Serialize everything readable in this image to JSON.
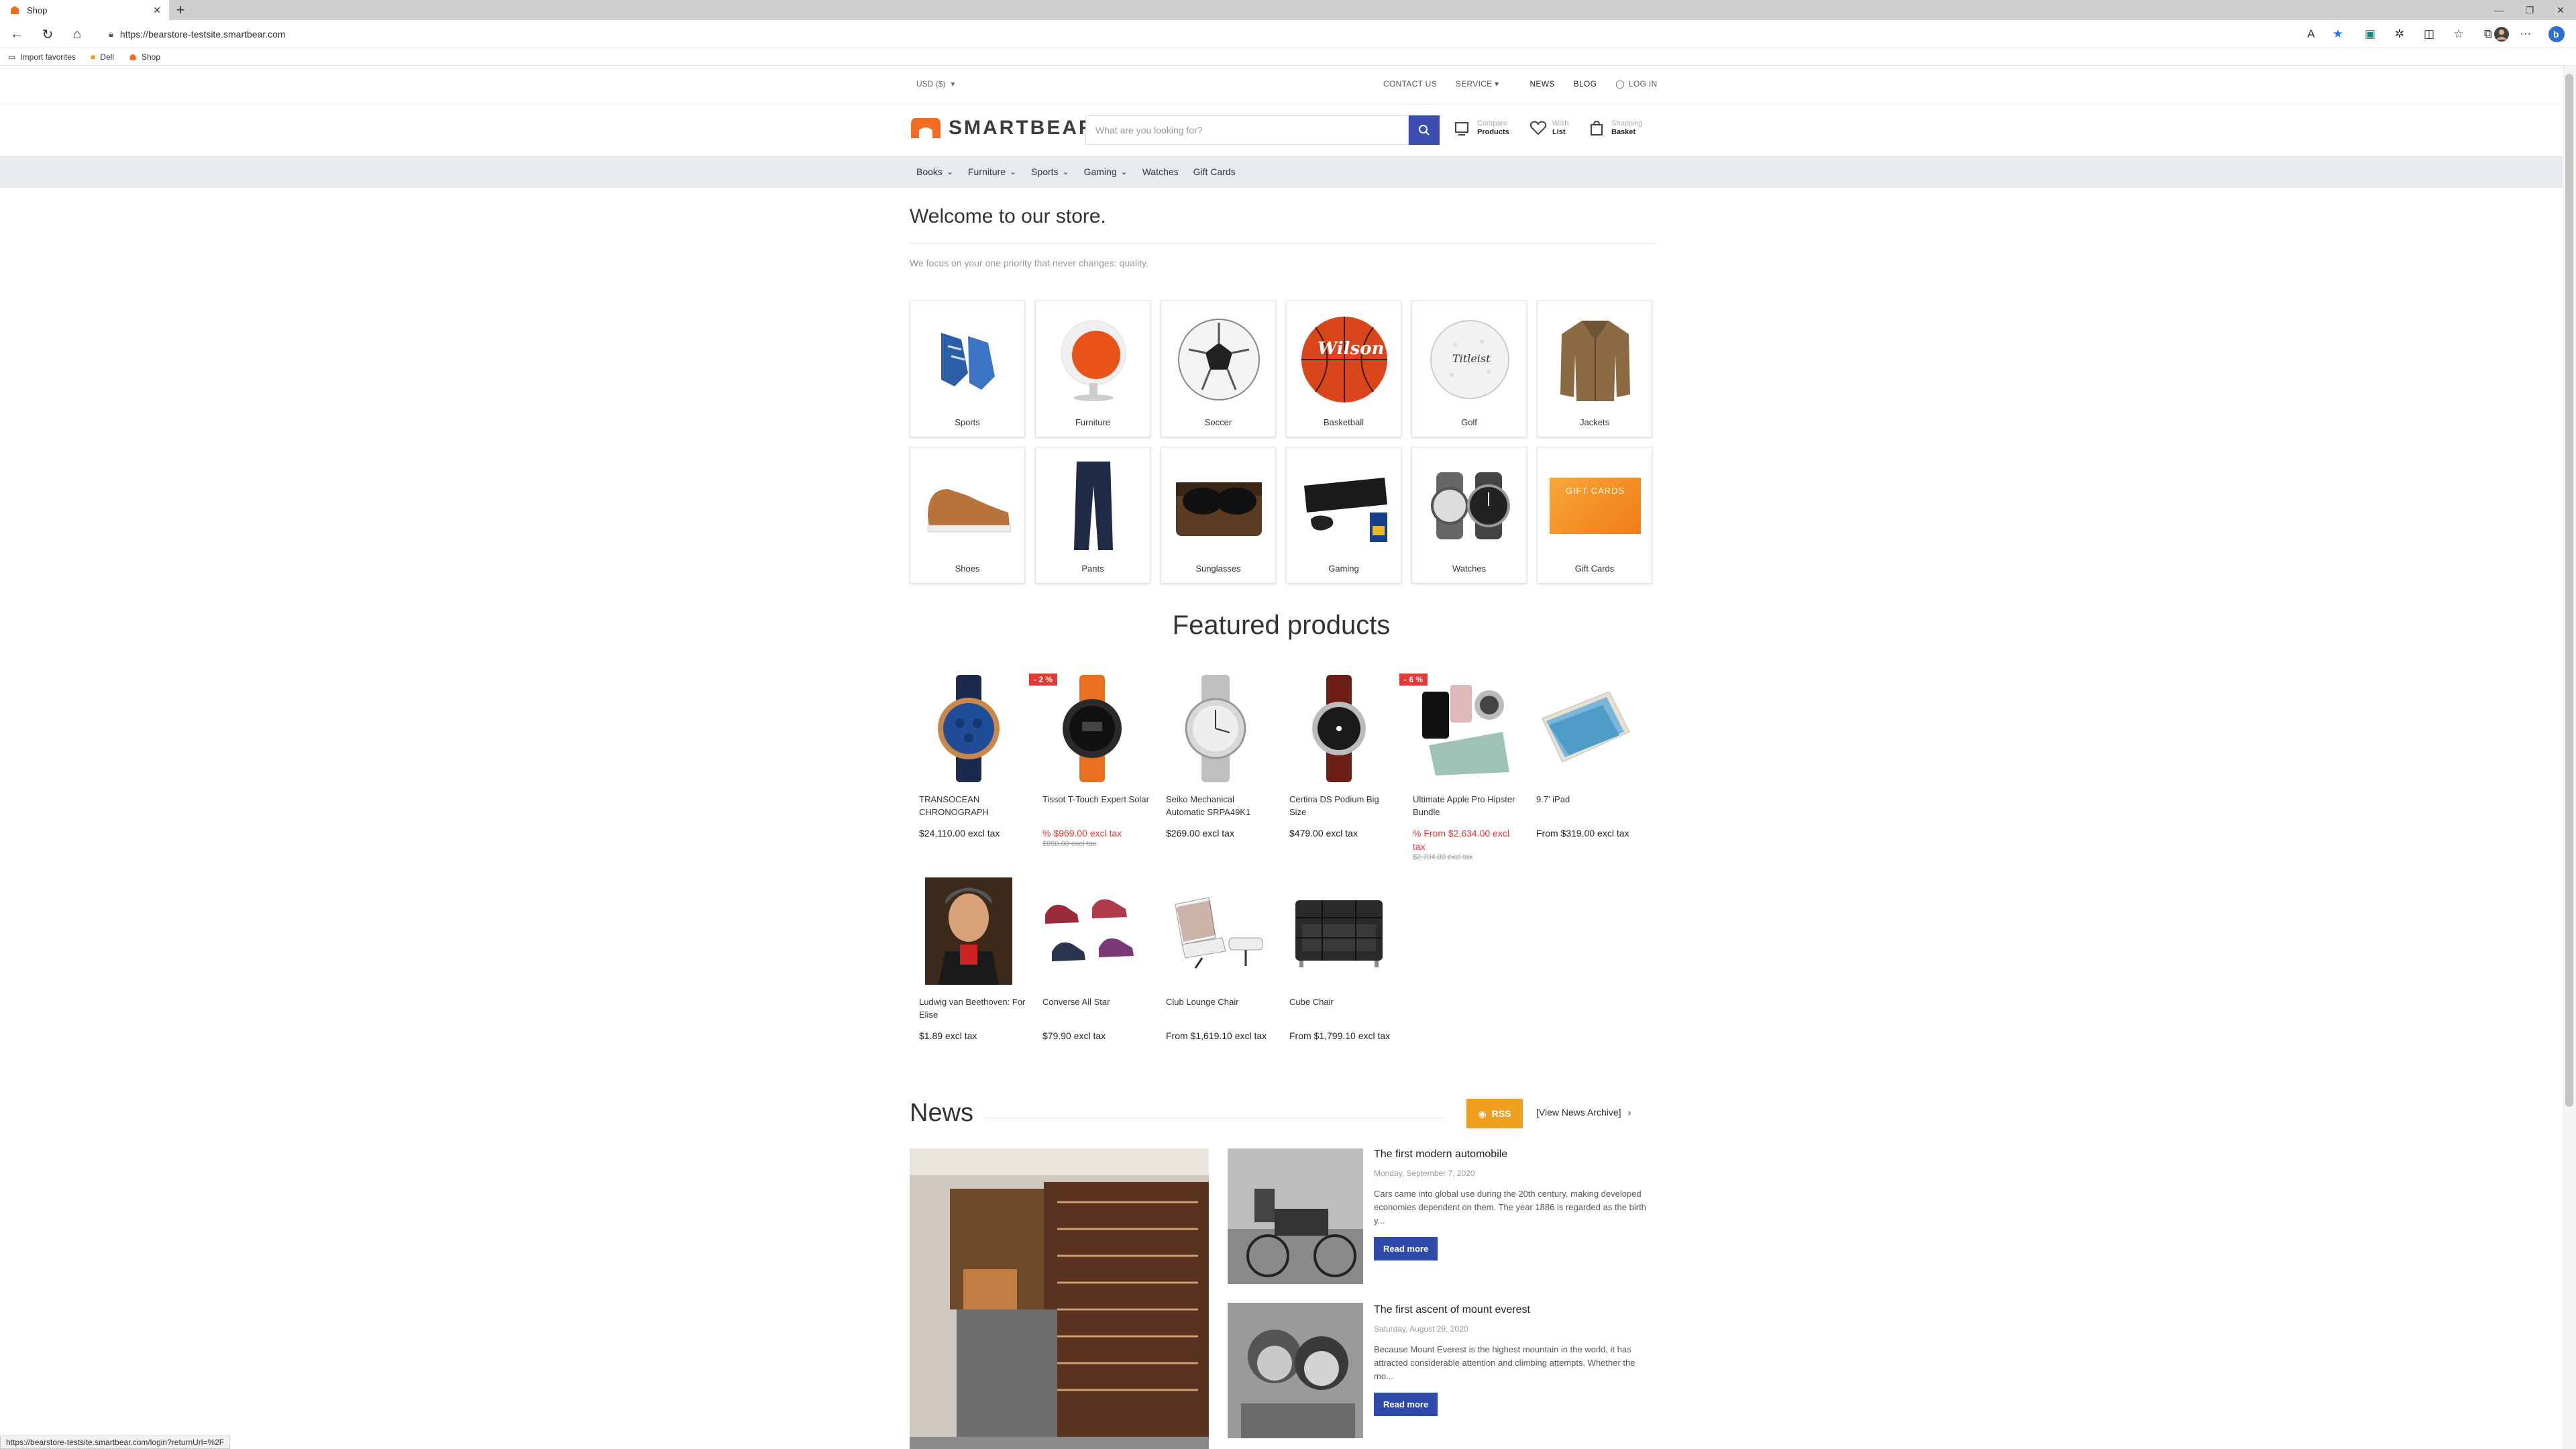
{
  "browser": {
    "tab_title": "Shop",
    "url": "https://bearstore-testsite.smartbear.com",
    "favorites": [
      "Import favorites",
      "Dell",
      "Shop"
    ],
    "status_url": "https://bearstore-testsite.smartbear.com/login?returnUrl=%2F"
  },
  "topbar": {
    "currency": "USD ($)",
    "contact": "CONTACT US",
    "service": "SERVICE",
    "news": "NEWS",
    "blog": "BLOG",
    "login": "LOG IN"
  },
  "header": {
    "logo_text": "SMARTBEAR",
    "search_placeholder": "What are you looking for?",
    "compare_top": "Compare",
    "compare_bottom": "Products",
    "wish_top": "Wish",
    "wish_bottom": "List",
    "basket_top": "Shopping",
    "basket_bottom": "Basket"
  },
  "catnav": [
    "Books",
    "Furniture",
    "Sports",
    "Gaming",
    "Watches",
    "Gift Cards"
  ],
  "welcome": {
    "title": "Welcome to our store.",
    "tagline": "We focus on your one priority that never changes: quality."
  },
  "categories": [
    {
      "name": "Sports",
      "icon": "sneaker-icon"
    },
    {
      "name": "Furniture",
      "icon": "egg-chair-icon"
    },
    {
      "name": "Soccer",
      "icon": "soccer-ball-icon"
    },
    {
      "name": "Basketball",
      "icon": "basketball-icon"
    },
    {
      "name": "Golf",
      "icon": "golf-ball-icon"
    },
    {
      "name": "Jackets",
      "icon": "jacket-icon"
    },
    {
      "name": "Shoes",
      "icon": "shoe-icon"
    },
    {
      "name": "Pants",
      "icon": "pants-icon"
    },
    {
      "name": "Sunglasses",
      "icon": "sunglasses-icon"
    },
    {
      "name": "Gaming",
      "icon": "console-icon"
    },
    {
      "name": "Watches",
      "icon": "watch-icon"
    },
    {
      "name": "Gift Cards",
      "icon": "gift-card-icon",
      "card_text": "GIFT CARDS"
    }
  ],
  "featured": {
    "title": "Featured products",
    "products": [
      {
        "name": "TRANSOCEAN CHRONOGRAPH",
        "price": "$24,110.00 excl tax"
      },
      {
        "name": "Tissot T-Touch Expert Solar",
        "badge": "- 2 %",
        "price": "% $969.00 excl tax",
        "old_price": "$990.00 excl tax"
      },
      {
        "name": "Seiko Mechanical Automatic SRPA49K1",
        "price": "$269.00 excl tax"
      },
      {
        "name": "Certina DS Podium Big Size",
        "price": "$479.00 excl tax"
      },
      {
        "name": "Ultimate Apple Pro Hipster Bundle",
        "badge": "- 6 %",
        "price": "% From $2,634.00 excl tax",
        "old_price": "$2,794.00 excl tax"
      },
      {
        "name": "9.7' iPad",
        "price": "From $319.00 excl tax"
      },
      {
        "name": "Ludwig van Beethoven: For Elise",
        "price": "$1.89 excl tax"
      },
      {
        "name": "Converse All Star",
        "price": "$79.90 excl tax"
      },
      {
        "name": "Club Lounge Chair",
        "price": "From $1,619.10 excl tax"
      },
      {
        "name": "Cube Chair",
        "price": "From $1,799.10 excl tax"
      }
    ]
  },
  "news": {
    "title": "News",
    "rss": "RSS",
    "archive": "[View News Archive]",
    "items": [
      {
        "title": "The first modern automobile",
        "date": "Monday, September 7, 2020",
        "excerpt": "Cars came into global use during the 20th century, making developed economies dependent on them. The year 1886 is regarded as the birth y...",
        "read_more": "Read more"
      },
      {
        "title": "The first ascent of mount everest",
        "date": "Saturday, August 29, 2020",
        "excerpt": "Because Mount Everest is the highest mountain in the world, it has attracted considerable attention and climbing attempts. Whether the mo...",
        "read_more": "Read more"
      }
    ]
  },
  "colors": {
    "brand_orange": "#f26c22",
    "primary_blue": "#3a4fb0",
    "sale_red": "#e53935",
    "rss_orange": "#f0a01f"
  }
}
